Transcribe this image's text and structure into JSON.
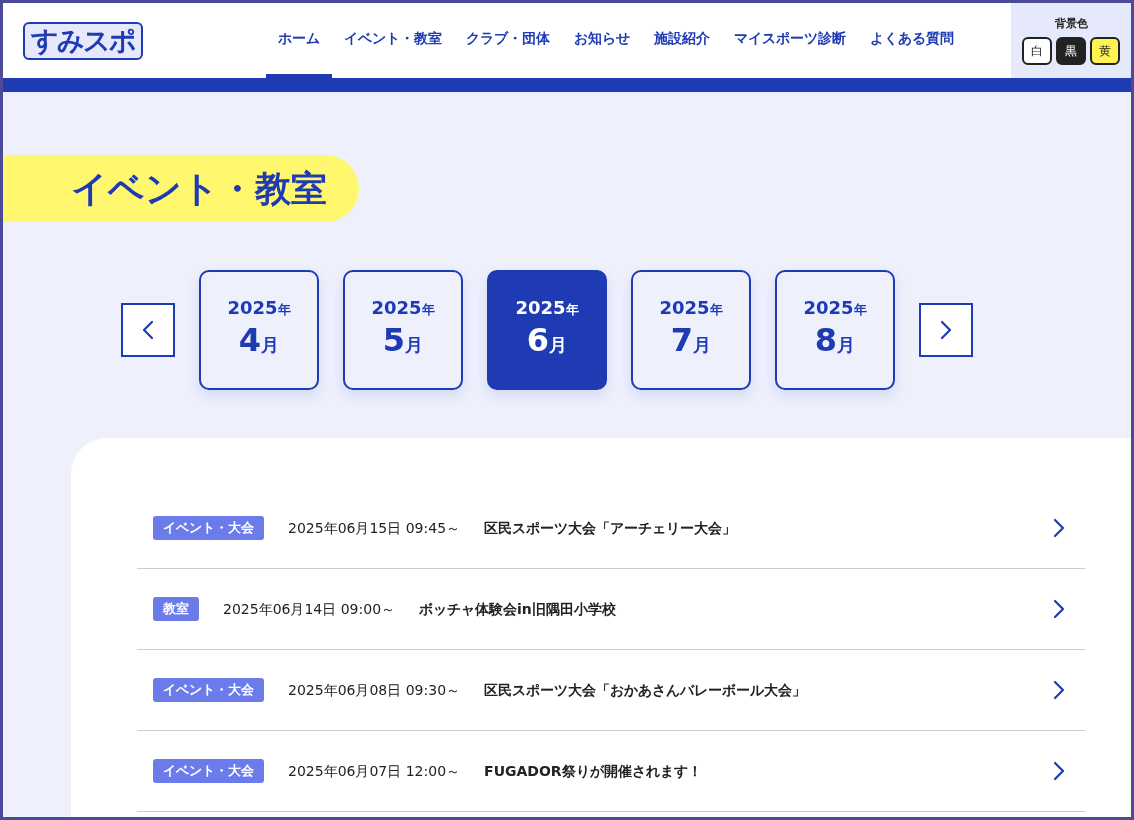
{
  "header": {
    "logo": "すみスポ",
    "nav": [
      {
        "label": "ホーム",
        "selected": true
      },
      {
        "label": "イベント・教室",
        "selected": false
      },
      {
        "label": "クラブ・団体",
        "selected": false
      },
      {
        "label": "お知らせ",
        "selected": false
      },
      {
        "label": "施設紹介",
        "selected": false
      },
      {
        "label": "マイスポーツ診断",
        "selected": false
      },
      {
        "label": "よくある質問",
        "selected": false
      }
    ],
    "background_color": {
      "label": "背景色",
      "options": [
        {
          "label": "白",
          "color": "#ffffff"
        },
        {
          "label": "黒",
          "color": "#222222"
        },
        {
          "label": "黄",
          "color": "#fff44f"
        }
      ]
    }
  },
  "page_title": "イベント・教室",
  "months": [
    {
      "year": "2025",
      "year_suffix": "年",
      "month": "4",
      "month_suffix": "月",
      "selected": false
    },
    {
      "year": "2025",
      "year_suffix": "年",
      "month": "5",
      "month_suffix": "月",
      "selected": false
    },
    {
      "year": "2025",
      "year_suffix": "年",
      "month": "6",
      "month_suffix": "月",
      "selected": true
    },
    {
      "year": "2025",
      "year_suffix": "年",
      "month": "7",
      "month_suffix": "月",
      "selected": false
    },
    {
      "year": "2025",
      "year_suffix": "年",
      "month": "8",
      "month_suffix": "月",
      "selected": false
    }
  ],
  "events": [
    {
      "category": "イベント・大会",
      "datetime": "2025年06月15日 09:45～",
      "title": "区民スポーツ大会「アーチェリー大会」"
    },
    {
      "category": "教室",
      "datetime": "2025年06月14日 09:00～",
      "title": "ボッチャ体験会in旧隅田小学校"
    },
    {
      "category": "イベント・大会",
      "datetime": "2025年06月08日 09:30～",
      "title": "区民スポーツ大会「おかあさんバレーボール大会」"
    },
    {
      "category": "イベント・大会",
      "datetime": "2025年06月07日 12:00～",
      "title": "FUGADOR祭りが開催されます！"
    }
  ]
}
